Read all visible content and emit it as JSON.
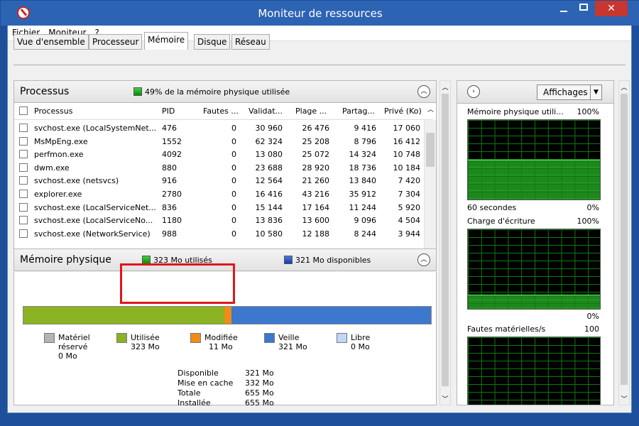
{
  "window": {
    "title": "Moniteur de ressources",
    "controls": {
      "minimize": "–",
      "maximize": "□",
      "close": "✕"
    }
  },
  "menu": [
    "Fichier",
    "Moniteur",
    "?"
  ],
  "tabs": [
    "Vue d'ensemble",
    "Processeur",
    "Mémoire",
    "Disque",
    "Réseau"
  ],
  "active_tab": "Mémoire",
  "processes_section": {
    "title": "Processus",
    "summary": "49% de la mémoire physique utilisée",
    "columns": [
      "Processus",
      "PID",
      "Fautes ...",
      "Validat...",
      "Plage ...",
      "Partag...",
      "Privé (Ko)"
    ],
    "rows": [
      [
        "svchost.exe (LocalSystemNet...",
        "476",
        "0",
        "30 960",
        "26 476",
        "9 416",
        "17 060"
      ],
      [
        "MsMpEng.exe",
        "1552",
        "0",
        "62 324",
        "25 208",
        "8 796",
        "16 412"
      ],
      [
        "perfmon.exe",
        "4092",
        "0",
        "13 080",
        "25 072",
        "14 324",
        "10 748"
      ],
      [
        "dwm.exe",
        "880",
        "0",
        "23 688",
        "28 920",
        "18 736",
        "10 184"
      ],
      [
        "svchost.exe (netsvcs)",
        "916",
        "0",
        "12 564",
        "21 260",
        "13 840",
        "7 420"
      ],
      [
        "explorer.exe",
        "2780",
        "0",
        "16 416",
        "43 216",
        "35 912",
        "7 304"
      ],
      [
        "svchost.exe (LocalServiceNet...",
        "836",
        "0",
        "15 144",
        "17 164",
        "11 244",
        "5 920"
      ],
      [
        "svchost.exe (LocalServiceNo...",
        "1180",
        "0",
        "13 836",
        "13 600",
        "9 096",
        "4 504"
      ],
      [
        "svchost.exe (NetworkService)",
        "988",
        "0",
        "10 580",
        "12 188",
        "8 244",
        "3 944"
      ]
    ]
  },
  "memory_section": {
    "title": "Mémoire physique",
    "used_label": "323 Mo utilisés",
    "available_label": "321 Mo disponibles",
    "bar": {
      "used_fraction": 0.493,
      "modified_fraction": 0.017,
      "standby_fraction": 0.49
    },
    "colors": {
      "reserved": "#b4b4b4",
      "used": "#8bb223",
      "modified": "#f08c14",
      "standby": "#3c78cd",
      "free": "#c0d8f5"
    },
    "legend": [
      {
        "name": "Matériel réservé",
        "value": "0 Mo"
      },
      {
        "name": "Utilisée",
        "value": "323 Mo"
      },
      {
        "name": "Modifiée",
        "value": "11 Mo"
      },
      {
        "name": "Veille",
        "value": "321 Mo"
      },
      {
        "name": "Libre",
        "value": "0 Mo"
      }
    ],
    "stats": [
      {
        "label": "Disponible",
        "value": "321 Mo"
      },
      {
        "label": "Mise en cache",
        "value": "332 Mo"
      },
      {
        "label": "Totale",
        "value": "655 Mo"
      },
      {
        "label": "Installée",
        "value": "655 Mo"
      }
    ]
  },
  "right_panel": {
    "views_button": "Affichages",
    "graphs": [
      {
        "title": "Mémoire physique utili...",
        "max": "100%",
        "footer_left": "60 secondes",
        "footer_right": "0%",
        "level": 0.5
      },
      {
        "title": "Charge d'écriture",
        "max": "100%",
        "footer_right": "0%",
        "level": 0.18
      },
      {
        "title": "Fautes matérielles/s",
        "max": "100"
      }
    ]
  }
}
